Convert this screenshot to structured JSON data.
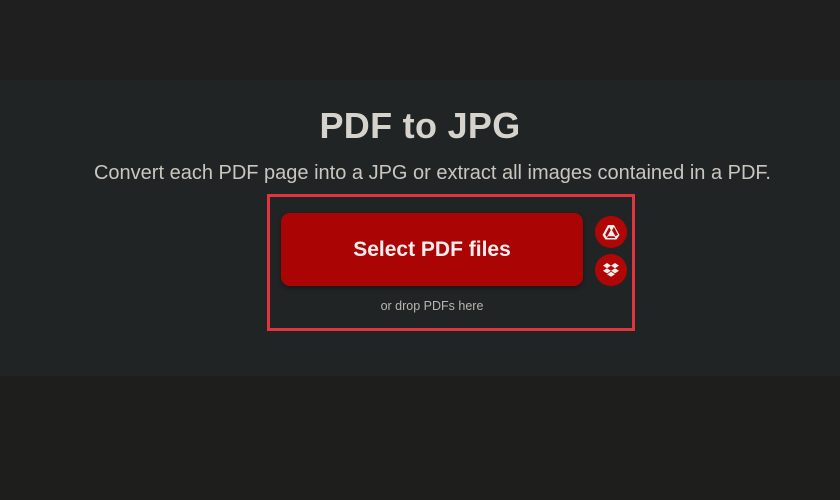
{
  "page": {
    "title": "PDF to JPG",
    "subtitle": "Convert each PDF page into a JPG or extract all images contained in a PDF."
  },
  "upload": {
    "select_label": "Select PDF files",
    "drop_hint": "or drop PDFs here",
    "cloud_sources": [
      {
        "name": "Google Drive",
        "icon": "google-drive-icon"
      },
      {
        "name": "Dropbox",
        "icon": "dropbox-icon"
      }
    ]
  },
  "colors": {
    "accent": "#ab0404",
    "highlight_border": "#e0343e",
    "background": "#202424"
  }
}
